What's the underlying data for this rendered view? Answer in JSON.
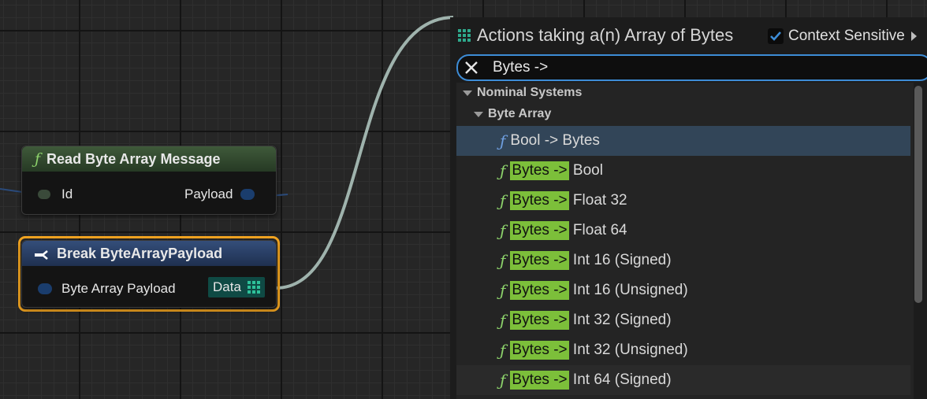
{
  "graph": {
    "node_read": {
      "title": "Read Byte Array Message",
      "pin_id": "Id",
      "pin_payload": "Payload"
    },
    "node_break": {
      "title": "Break ByteArrayPayload",
      "pin_in": "Byte Array Payload",
      "pin_out": "Data"
    }
  },
  "panel": {
    "title": "Actions taking a(n) Array of Bytes",
    "context_label": "Context Sensitive",
    "context_checked": true,
    "search_value": "Bytes ->",
    "category": "Nominal Systems",
    "subcategory": "Byte Array",
    "items": [
      {
        "highlight": "",
        "text": "Bool -> Bytes"
      },
      {
        "highlight": "Bytes ->",
        "text": " Bool"
      },
      {
        "highlight": "Bytes ->",
        "text": " Float 32"
      },
      {
        "highlight": "Bytes ->",
        "text": " Float 64"
      },
      {
        "highlight": "Bytes ->",
        "text": " Int 16 (Signed)"
      },
      {
        "highlight": "Bytes ->",
        "text": " Int 16 (Unsigned)"
      },
      {
        "highlight": "Bytes ->",
        "text": " Int 32 (Signed)"
      },
      {
        "highlight": "Bytes ->",
        "text": " Int 32 (Unsigned)"
      },
      {
        "highlight": "Bytes ->",
        "text": " Int 64 (Signed)"
      }
    ]
  },
  "icons": {
    "function": "f-function-icon",
    "break": "break-struct-icon",
    "array": "array-grid-icon",
    "close": "close-icon",
    "check": "check-icon"
  },
  "colors": {
    "selection_border": "#f3a521",
    "search_border": "#3d8cd6",
    "match_highlight": "#7cbf3a",
    "wire": "#9fb3ad"
  }
}
